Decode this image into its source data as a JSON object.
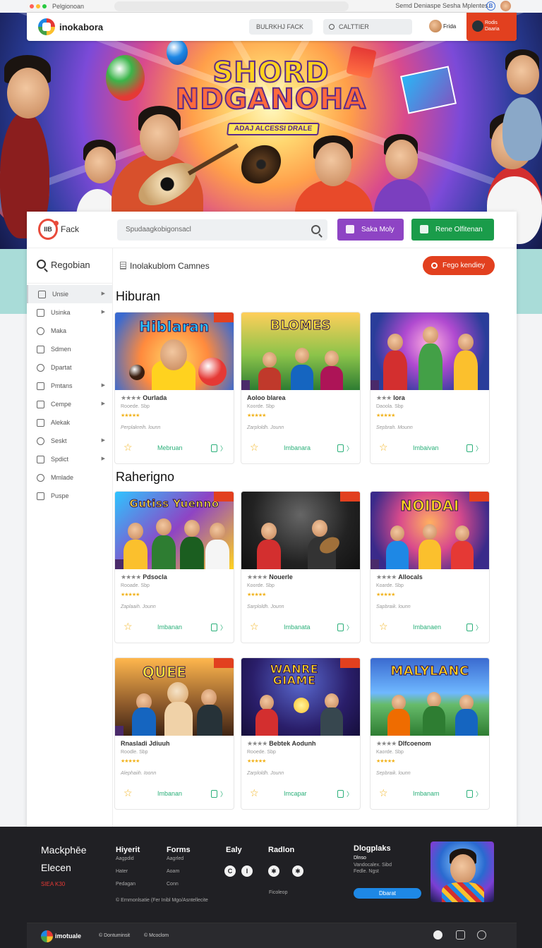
{
  "browser": {
    "tab_title": "Pelgionoan",
    "right_text": "Semd Deniaspe Sesha Mplentes.",
    "profile_icon": "B"
  },
  "navbar": {
    "brand": "inokabora",
    "nav_link": "BULRKHJ FACK",
    "search_placeholder": "CALTTIER",
    "user_label": "Frida",
    "cta_line1": "Rodis",
    "cta_line2": "Daaria"
  },
  "hero": {
    "title_line1": "SHORD",
    "title_line2": "NDGANOHA",
    "subtitle": "ADAJ ALCESSI DRALE"
  },
  "topbar": {
    "brand": "Fack",
    "logo_text": "IIB",
    "search_placeholder": "Spudaagkobigonsacl",
    "btn1": "Saka Moly",
    "btn2": "Rene Olfitenan"
  },
  "sidebar": {
    "search_label": "Regobian",
    "items": [
      {
        "label": "Unsie",
        "chevron": true
      },
      {
        "label": "Usinka",
        "chevron": true
      },
      {
        "label": "Maka",
        "chevron": false
      },
      {
        "label": "Sdmen",
        "chevron": false
      },
      {
        "label": "Dpartat",
        "chevron": false
      },
      {
        "label": "Pmtans",
        "chevron": true
      },
      {
        "label": "Cempe",
        "chevron": true
      },
      {
        "label": "Alekak",
        "chevron": false
      },
      {
        "label": "Seskt",
        "chevron": true
      },
      {
        "label": "Spdict",
        "chevron": true
      },
      {
        "label": "Mmlade",
        "chevron": false
      },
      {
        "label": "Puspe",
        "chevron": false
      }
    ]
  },
  "content": {
    "breadcrumb": "Inolakublom  Camnes",
    "filter_button": "Fego kendiey"
  },
  "sections": [
    {
      "title": "Hiburan",
      "cards": [
        {
          "thumb_title": "Hiblaran",
          "title": "Ourlada",
          "meta": "Rooede. Sbp",
          "author": "Perplakreih. lounn",
          "category": "Mebruan"
        },
        {
          "thumb_title": "BLOMES",
          "title": "Aoloo blarea",
          "meta": "Koorde. Sbp",
          "author": "Zarploldh. Jounn",
          "category": "Imbanara"
        },
        {
          "thumb_title": "",
          "title": "Iora",
          "meta": "Daoola. Sbp",
          "author": "Sepbrah. Mounn",
          "category": "Imbaivan"
        }
      ]
    },
    {
      "title": "Raherigno",
      "cards": [
        {
          "thumb_title": "Gutiss Yuenno",
          "title": "Pdsocla",
          "meta": "Rooade. Sbp",
          "author": "Zaplaaih. Jounn",
          "category": "Imbanan"
        },
        {
          "thumb_title": "",
          "title": "Nouerle",
          "meta": "Koorde. Sbp",
          "author": "Sarploldh. Jounn",
          "category": "Imbanata"
        },
        {
          "thumb_title": "NOIDAI",
          "title": "Allocals",
          "meta": "Koarde. Sbp",
          "author": "Sapbraik. lounn",
          "category": "Imbanaen"
        }
      ]
    },
    {
      "title": "",
      "cards": [
        {
          "thumb_title": "QUEE",
          "title": "Rnasladi Jdiuuh",
          "meta": "Roodle. Sbp",
          "author": "Alephaiih. Ioonn",
          "category": "Imbanan"
        },
        {
          "thumb_title": "WANRE GIAME",
          "title": "Bebtek Aodunh",
          "meta": "Rooede. Sbp",
          "author": "Zarploldh. Jounn",
          "category": "Imcapar"
        },
        {
          "thumb_title": "MALYLANC",
          "title": "Dlfcoenom",
          "meta": "Kaorde. Sbp",
          "author": "Sepbraik. lounn",
          "category": "Imbanam"
        }
      ]
    }
  ],
  "footer": {
    "brand_line1": "Mackphēe",
    "brand_line2": "Elecen",
    "brand_tag": "SIEA K30",
    "col1_title": "Hiyerit",
    "col1_links": [
      "Aagpdid",
      "Hater",
      "Pedagan"
    ],
    "col2_title": "Forms",
    "col2_links": [
      "Aagrled",
      "Aoam",
      "Conn"
    ],
    "col3_title": "Ealy",
    "col4_title": "Radlon",
    "col4_link": "Ficoleop",
    "copyright": "© Ernmonlsatie (Fer Inibl Mgo/Asntellecite",
    "promo_title": "Dlogplaks",
    "promo_line1": "Dlnso",
    "promo_line2": "Vandocalex. Sibd",
    "promo_line3": "Fedle. Ngst",
    "promo_button": "Dbarat",
    "bottom_brand": "imotuale",
    "bottom_link1": "Dontuminsit",
    "bottom_link2": "Mcoclom"
  }
}
